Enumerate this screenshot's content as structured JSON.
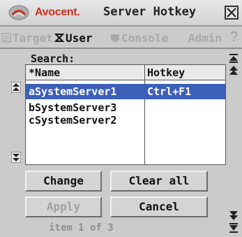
{
  "window": {
    "brand": "Avocent.",
    "title": "Server Hotkey",
    "close_icon": "close-icon"
  },
  "tabs": [
    {
      "label": "Target",
      "icon": "target-icon",
      "active": false
    },
    {
      "label": "User",
      "icon": "user-icon",
      "active": true
    },
    {
      "label": "Console",
      "icon": "console-icon",
      "active": false
    },
    {
      "label": "Admin",
      "icon": "",
      "active": false
    }
  ],
  "help": {
    "label": "?"
  },
  "search": {
    "label": "Search:"
  },
  "table": {
    "columns": [
      "*Name",
      "Hotkey"
    ],
    "rows": [
      {
        "name": "aSystemServer1",
        "hotkey": "Ctrl+F1",
        "selected": true
      },
      {
        "name": "bSystemServer3",
        "hotkey": "",
        "selected": false
      },
      {
        "name": "cSystemServer2",
        "hotkey": "",
        "selected": false
      }
    ]
  },
  "buttons": {
    "change": "Change",
    "clear_all": "Clear all",
    "apply": "Apply",
    "cancel": "Cancel"
  },
  "status": {
    "item_count": "item 1 of 3"
  },
  "colors": {
    "selection": "#3c5fb8",
    "brand": "#c8321e"
  }
}
